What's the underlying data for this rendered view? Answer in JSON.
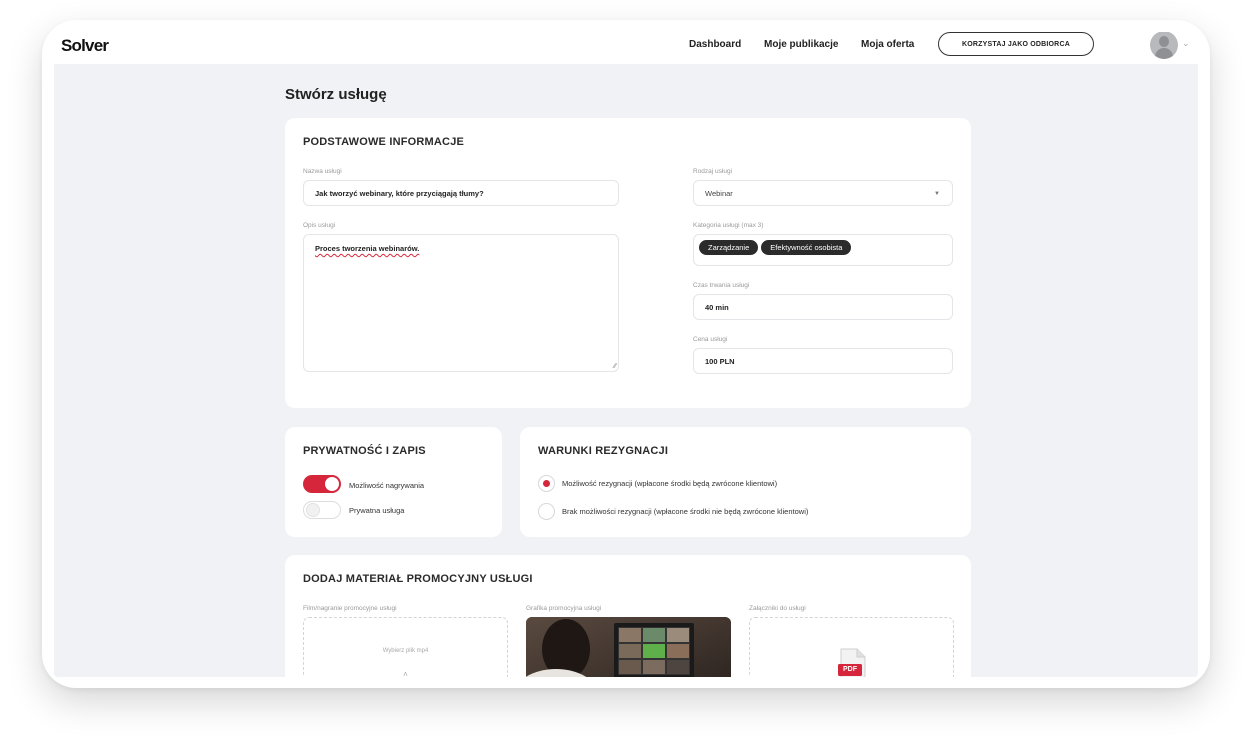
{
  "nav": {
    "logo": "Solver",
    "links": [
      "Dashboard",
      "Moje publikacje",
      "Moja oferta"
    ],
    "cta": "KORZYSTAJ JAKO ODBIORCA"
  },
  "page": {
    "title": "Stwórz usługę"
  },
  "basic": {
    "title": "PODSTAWOWE INFORMACJE",
    "name_label": "Nazwa usługi",
    "name_value": "Jak tworzyć webinary, które przyciągają tłumy?",
    "desc_label": "Opis usługi",
    "desc_value": "Proces tworzenia webinarów.",
    "type_label": "Rodzaj usługi",
    "type_value": "Webinar",
    "cat_label": "Kategoria usługi (max 3)",
    "categories": [
      "Zarządzanie",
      "Efektywność osobista"
    ],
    "duration_label": "Czas trwania usługi",
    "duration_value": "40 min",
    "price_label": "Cena usługi",
    "price_value": "100 PLN"
  },
  "privacy": {
    "title": "PRYWATNOŚĆ I ZAPIS",
    "options": [
      {
        "label": "Możliwość nagrywania",
        "on": true
      },
      {
        "label": "Prywatna usługa",
        "on": false
      }
    ]
  },
  "cancel": {
    "title": "WARUNKI REZYGNACJI",
    "options": [
      {
        "label": "Możliwość rezygnacji (wpłacone środki będą zwrócone klientowi)",
        "selected": true
      },
      {
        "label": "Brak możliwości rezygnacji (wpłacone środki nie będą zwrócone klientowi)",
        "selected": false
      }
    ]
  },
  "promo": {
    "title": "DODAJ MATERIAŁ PROMOCYJNY USŁUGI",
    "video_label": "Film/nagranie promocyjne usługi",
    "video_hint": "Wybierz plik mp4",
    "image_label": "Grafika promocyjna usługi",
    "files_label": "Załączniki do usługi",
    "pdf_text": "PDF"
  },
  "colors": {
    "accent": "#d5263c",
    "tag_bg": "#2b2b2b",
    "screen_bg": "#f1f2f5"
  }
}
